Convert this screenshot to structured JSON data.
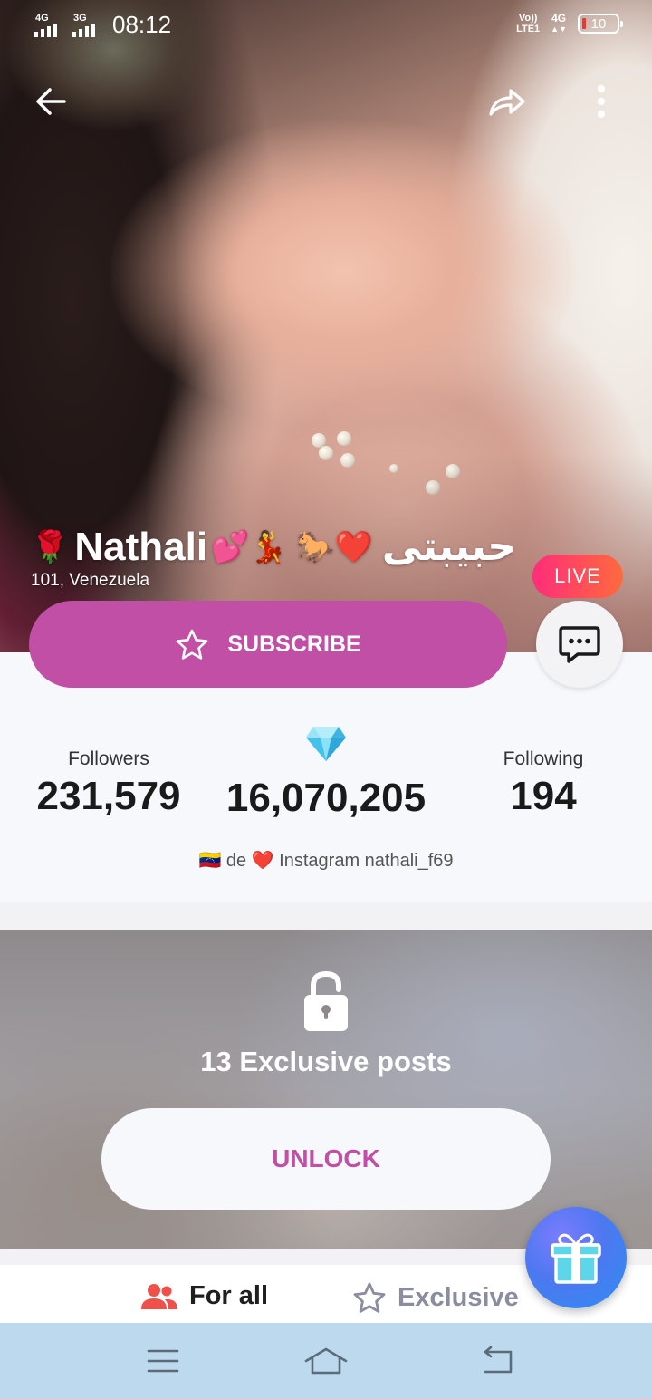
{
  "status_bar": {
    "sim1_network": "4G",
    "sim2_network": "3G",
    "time": "08:12",
    "volte_label": "Vo))",
    "lte_label": "LTE1",
    "data_network": "4G",
    "battery_level": "10"
  },
  "profile": {
    "name": "Nathali",
    "name_suffix": "حبيبتى",
    "location": "101, Venezuela",
    "live_label": "LIVE",
    "subscribe_label": "SUBSCRIBE",
    "followers_label": "Followers",
    "followers_count": "231,579",
    "diamonds_count": "16,070,205",
    "following_label": "Following",
    "following_count": "194",
    "bio_text": " de  Instagram nathali_f69"
  },
  "locked": {
    "count_text": "13 Exclusive posts",
    "unlock_label": "UNLOCK"
  },
  "tabs": {
    "for_all": "For all",
    "exclusive": "Exclusive"
  },
  "colors": {
    "accent": "#c04fa5",
    "live_gradient_start": "#ff2d7a",
    "live_gradient_end": "#ff6a3d",
    "nav_bar": "#bcd9ee",
    "tab_icon_red": "#f0504a"
  },
  "icons": [
    "back-arrow-icon",
    "share-icon",
    "more-vert-icon",
    "star-icon",
    "chat-icon",
    "diamond-icon",
    "lock-icon",
    "people-icon",
    "star-outline-icon",
    "gift-icon",
    "menu-icon",
    "home-icon",
    "back-icon"
  ]
}
